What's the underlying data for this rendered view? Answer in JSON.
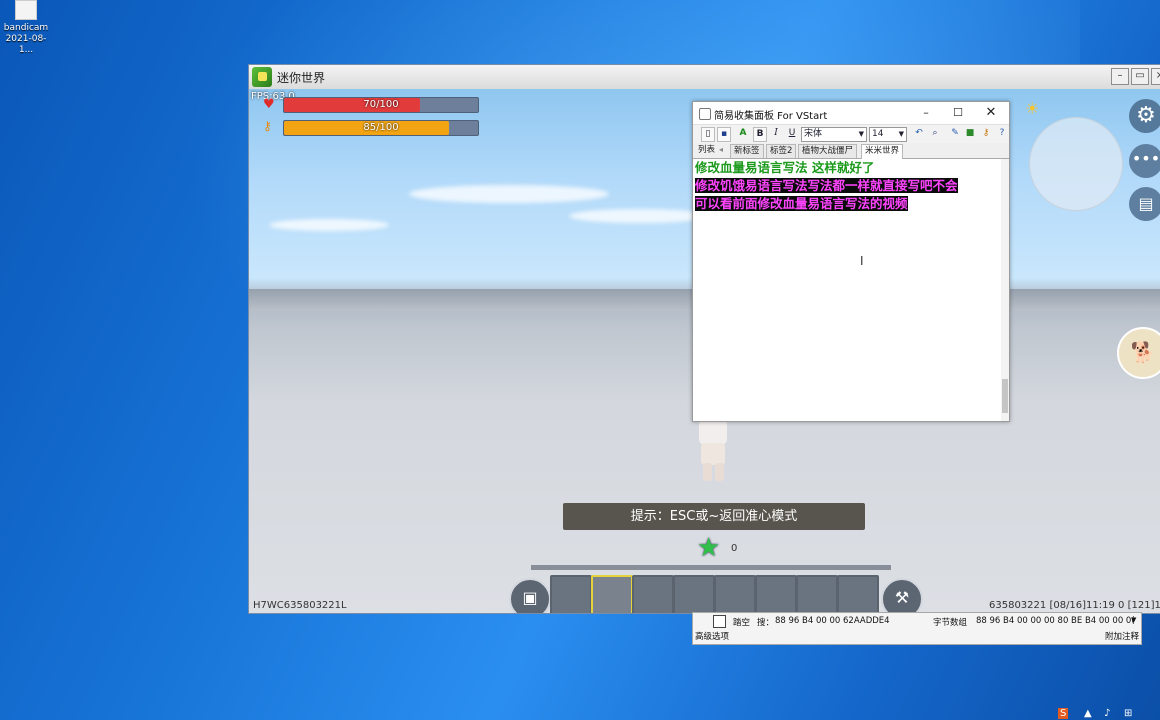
{
  "desktop": {
    "icon_label": "bandicam",
    "icon_sublabel": "2021-08-1..."
  },
  "game": {
    "title": "迷你世界",
    "fps": "FPS:63.0",
    "health": {
      "text": "70/100",
      "value": 70,
      "max": 100,
      "color": "#e23b3b"
    },
    "hunger": {
      "text": "85/100",
      "value": 85,
      "max": 100,
      "color": "#f2a413"
    },
    "hint": "提示：ESC或~返回准心模式",
    "star_count": "0",
    "bottom_left": "H7WC635803221L",
    "bottom_right": "635803221   [08/16]11:19 0   [121]1.",
    "hotbar_selected": 1,
    "icons": {
      "gear": "gear-icon",
      "more": "more-icon",
      "book": "book-icon",
      "pet": "dog-icon",
      "sun": "sun-icon"
    }
  },
  "editor": {
    "title": "简易收集面板 For VStart",
    "toolbar": {
      "bold": "B",
      "italic": "I",
      "underline": "U",
      "font": "宋体",
      "size": "14"
    },
    "tabs": [
      "列表",
      "新标签",
      "标签2",
      "植物大战僵尸",
      "米米世界"
    ],
    "active_tab": 4,
    "lines": [
      "修改血量易语言写法  这样就好了",
      "修改饥饿易语言写法写法都一样就直接写吧不会",
      "可以看前面修改血量易语言写法的视频"
    ]
  },
  "panel": {
    "checkbox_label": "踏空",
    "search_label": "搜：",
    "search_value": "88 96 B4 00 00 62AADDE4",
    "bytes_label": "字节数组",
    "bytes_value": "88 96 B4 00 00 00 80 BE B4 00 00 0(",
    "advanced": "高级选项",
    "add_note": "附加注释"
  },
  "colors": {
    "line1": "#1c9a1c",
    "highlight_text": "#ff44ff",
    "highlight_bg": "#0b0b0b"
  }
}
